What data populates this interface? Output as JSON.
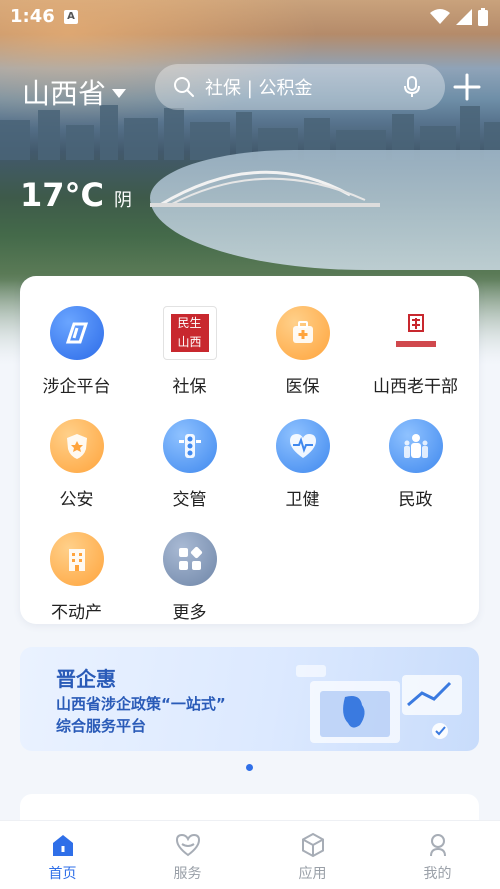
{
  "status_bar": {
    "time": "1:46",
    "badge": "A"
  },
  "header": {
    "region": "山西省",
    "search_placeholder": "社保 | 公积金"
  },
  "weather": {
    "temperature": "17°C",
    "condition": "阴"
  },
  "services": [
    {
      "label": "涉企平台",
      "icon": "business-platform-icon"
    },
    {
      "label": "社保",
      "icon": "social-security-seal-icon"
    },
    {
      "label": "医保",
      "icon": "medical-kit-icon"
    },
    {
      "label": "山西老干部",
      "icon": "veteran-cadre-logo-icon"
    },
    {
      "label": "公安",
      "icon": "police-badge-icon"
    },
    {
      "label": "交管",
      "icon": "traffic-light-icon"
    },
    {
      "label": "卫健",
      "icon": "heartbeat-icon"
    },
    {
      "label": "民政",
      "icon": "people-icon"
    },
    {
      "label": "不动产",
      "icon": "building-icon"
    },
    {
      "label": "更多",
      "icon": "more-apps-icon"
    }
  ],
  "banner": {
    "title": "晋企惠",
    "subtitle_line1": "山西省涉企政策“一站式”",
    "subtitle_line2": "综合服务平台"
  },
  "tabs": [
    {
      "label": "首页",
      "active": true,
      "icon": "home-icon"
    },
    {
      "label": "服务",
      "active": false,
      "icon": "heart-hand-icon"
    },
    {
      "label": "应用",
      "active": false,
      "icon": "cube-icon"
    },
    {
      "label": "我的",
      "active": false,
      "icon": "person-icon"
    }
  ],
  "colors": {
    "accent": "#2f6fe8",
    "banner_text": "#2a5bb8",
    "seal_red": "#c8282e"
  }
}
